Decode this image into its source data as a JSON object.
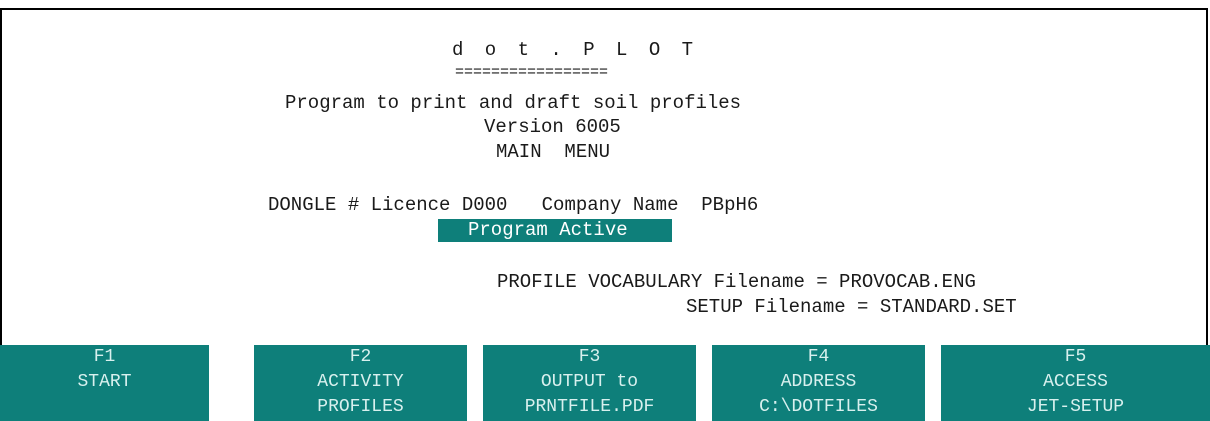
{
  "header": {
    "title": "d o t . P L O T",
    "underline": "=================",
    "subtitle": "Program to print and draft soil profiles",
    "version": "Version 6005",
    "menu": "MAIN  MENU"
  },
  "licence": {
    "text": "DONGLE # Licence D000   Company Name  PBpH6",
    "status": "Program Active"
  },
  "files": {
    "vocabulary": "PROFILE VOCABULARY Filename = PROVOCAB.ENG",
    "setup": "SETUP Filename = STANDARD.SET"
  },
  "function_keys": [
    {
      "key": "F1",
      "line1": "START",
      "line2": ""
    },
    {
      "key": "F2",
      "line1": "ACTIVITY",
      "line2": "PROFILES"
    },
    {
      "key": "F3",
      "line1": "OUTPUT to",
      "line2": "PRNTFILE.PDF"
    },
    {
      "key": "F4",
      "line1": "ADDRESS",
      "line2": "C:\\DOTFILES"
    },
    {
      "key": "F5",
      "line1": "ACCESS",
      "line2": "JET-SETUP"
    }
  ],
  "colors": {
    "highlight": "#0e7f7a",
    "background": "#ffffff",
    "text": "#1a1a1a"
  }
}
